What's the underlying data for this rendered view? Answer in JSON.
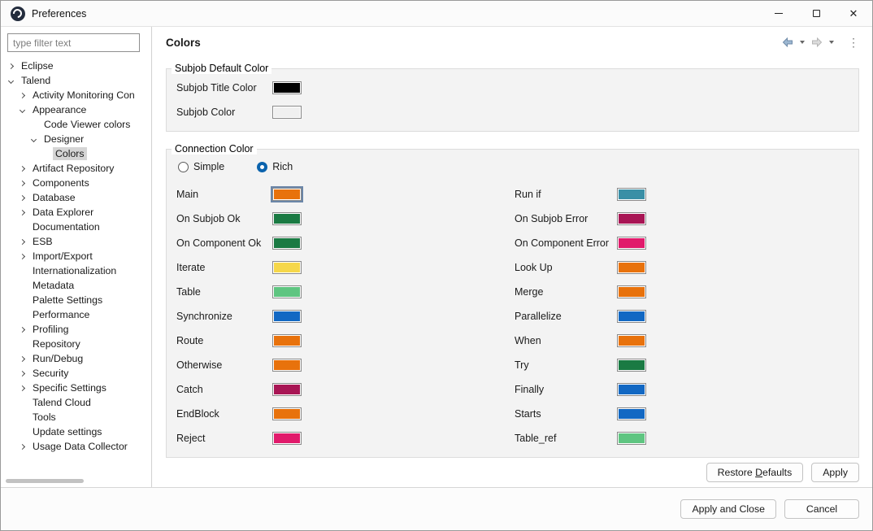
{
  "window": {
    "title": "Preferences",
    "controls": {
      "minimize": "minimize",
      "maximize": "maximize",
      "close": "close"
    }
  },
  "icons": {
    "app": "talend-logo",
    "back": "back-arrow",
    "back_dropdown": "chevron-down",
    "forward": "forward-arrow",
    "forward_dropdown": "chevron-down",
    "view_menu": "vertical-dots"
  },
  "sidebar": {
    "filter_placeholder": "type filter text",
    "tree": [
      {
        "label": "Eclipse",
        "arrow": "collapsed",
        "level": 0
      },
      {
        "label": "Talend",
        "arrow": "expanded",
        "level": 0
      },
      {
        "label": "Activity Monitoring Con",
        "arrow": "collapsed",
        "level": 1
      },
      {
        "label": "Appearance",
        "arrow": "expanded",
        "level": 1
      },
      {
        "label": "Code Viewer colors",
        "arrow": "none",
        "level": 2
      },
      {
        "label": "Designer",
        "arrow": "expanded",
        "level": 2
      },
      {
        "label": "Colors",
        "arrow": "none",
        "level": 3,
        "selected": true
      },
      {
        "label": "Artifact Repository",
        "arrow": "collapsed",
        "level": 1
      },
      {
        "label": "Components",
        "arrow": "collapsed",
        "level": 1
      },
      {
        "label": "Database",
        "arrow": "collapsed",
        "level": 1
      },
      {
        "label": "Data Explorer",
        "arrow": "collapsed",
        "level": 1
      },
      {
        "label": "Documentation",
        "arrow": "none",
        "level": 1
      },
      {
        "label": "ESB",
        "arrow": "collapsed",
        "level": 1
      },
      {
        "label": "Import/Export",
        "arrow": "collapsed",
        "level": 1
      },
      {
        "label": "Internationalization",
        "arrow": "none",
        "level": 1
      },
      {
        "label": "Metadata",
        "arrow": "none",
        "level": 1
      },
      {
        "label": "Palette Settings",
        "arrow": "none",
        "level": 1
      },
      {
        "label": "Performance",
        "arrow": "none",
        "level": 1
      },
      {
        "label": "Profiling",
        "arrow": "collapsed",
        "level": 1
      },
      {
        "label": "Repository",
        "arrow": "none",
        "level": 1
      },
      {
        "label": "Run/Debug",
        "arrow": "collapsed",
        "level": 1
      },
      {
        "label": "Security",
        "arrow": "collapsed",
        "level": 1
      },
      {
        "label": "Specific Settings",
        "arrow": "collapsed",
        "level": 1
      },
      {
        "label": "Talend Cloud",
        "arrow": "none",
        "level": 1
      },
      {
        "label": "Tools",
        "arrow": "none",
        "level": 1
      },
      {
        "label": "Update settings",
        "arrow": "none",
        "level": 1
      },
      {
        "label": "Usage Data Collector",
        "arrow": "collapsed",
        "level": 1
      }
    ]
  },
  "page": {
    "title": "Colors"
  },
  "subjob_group": {
    "title": "Subjob Default Color",
    "rows": [
      {
        "label": "Subjob Title Color",
        "color": "#000000"
      },
      {
        "label": "Subjob Color",
        "color": "#f0f0f0"
      }
    ]
  },
  "connection_group": {
    "title": "Connection Color",
    "radio_simple": {
      "label": "Simple",
      "checked": false
    },
    "radio_rich": {
      "label": "Rich",
      "checked": true
    },
    "left": [
      {
        "label": "Main",
        "color": "#E8720C",
        "focused": true
      },
      {
        "label": "On Subjob Ok",
        "color": "#1A7A43"
      },
      {
        "label": "On Component Ok",
        "color": "#1A7A43"
      },
      {
        "label": "Iterate",
        "color": "#F6D74A"
      },
      {
        "label": "Table",
        "color": "#5FC581"
      },
      {
        "label": "Synchronize",
        "color": "#1268C3"
      },
      {
        "label": "Route",
        "color": "#E8720C"
      },
      {
        "label": "Otherwise",
        "color": "#E8720C"
      },
      {
        "label": "Catch",
        "color": "#A81554"
      },
      {
        "label": "EndBlock",
        "color": "#E8720C"
      },
      {
        "label": "Reject",
        "color": "#E11A6B"
      }
    ],
    "right": [
      {
        "label": "Run if",
        "color": "#3A8FA6"
      },
      {
        "label": "On Subjob Error",
        "color": "#A81554"
      },
      {
        "label": "On Component Error",
        "color": "#E11A6B"
      },
      {
        "label": "Look Up",
        "color": "#E8720C"
      },
      {
        "label": "Merge",
        "color": "#E8720C"
      },
      {
        "label": "Parallelize",
        "color": "#1268C3"
      },
      {
        "label": "When",
        "color": "#E8720C"
      },
      {
        "label": "Try",
        "color": "#1A7A43"
      },
      {
        "label": "Finally",
        "color": "#1268C3"
      },
      {
        "label": "Starts",
        "color": "#1268C3"
      },
      {
        "label": "Table_ref",
        "color": "#5FC581"
      }
    ]
  },
  "actions": {
    "restore_defaults": {
      "pre": "Restore ",
      "key": "D",
      "post": "efaults"
    },
    "apply": "Apply",
    "apply_and_close": "Apply and Close",
    "cancel": "Cancel"
  }
}
